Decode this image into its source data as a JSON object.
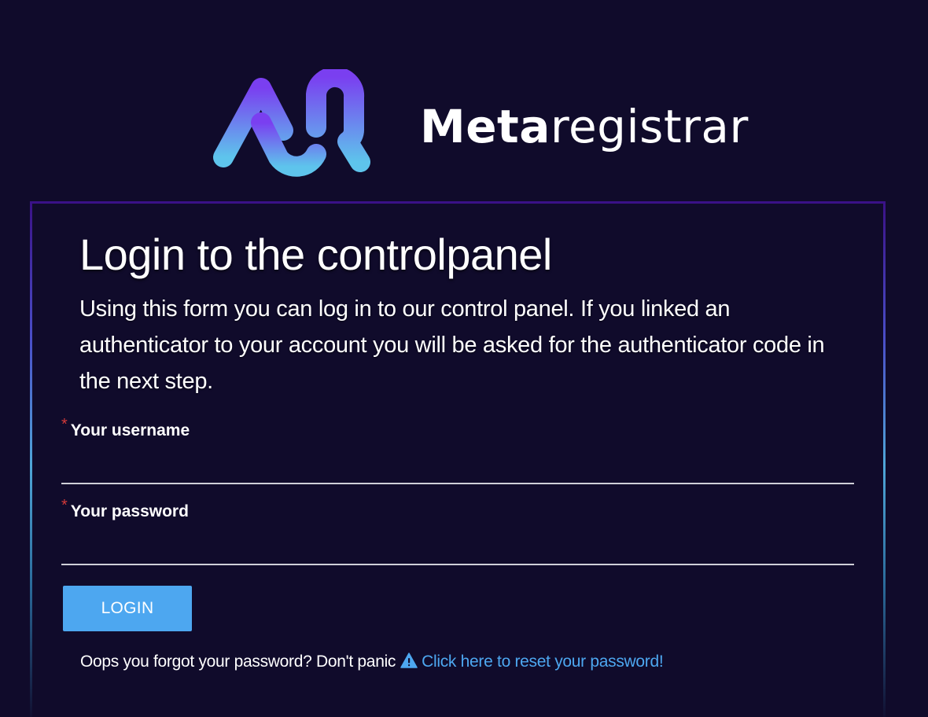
{
  "brand": {
    "name_bold": "Meta",
    "name_light": "registrar",
    "logo_icon": "ar-monogram-logo",
    "gradient_top": "#7a3ff0",
    "gradient_bottom": "#5ec4ec"
  },
  "login": {
    "title": "Login to the controlpanel",
    "intro": "Using this form you can log in to our control panel. If you linked an authenticator to your account you will be asked for the authenticator code in the next step.",
    "required_marker": "*",
    "username_label": "Your username",
    "username_value": "",
    "password_label": "Your password",
    "password_value": "",
    "button_label": "LOGIN",
    "forgot_text": "Oops you forgot your password? Don't panic",
    "forgot_icon": "warning-icon",
    "reset_link_label": "Click here to reset your password!"
  },
  "colors": {
    "background": "#100b2b",
    "button": "#4da7f0",
    "link": "#4da7f0",
    "required": "#d23a3a",
    "card_border_top": "#3a1187"
  }
}
